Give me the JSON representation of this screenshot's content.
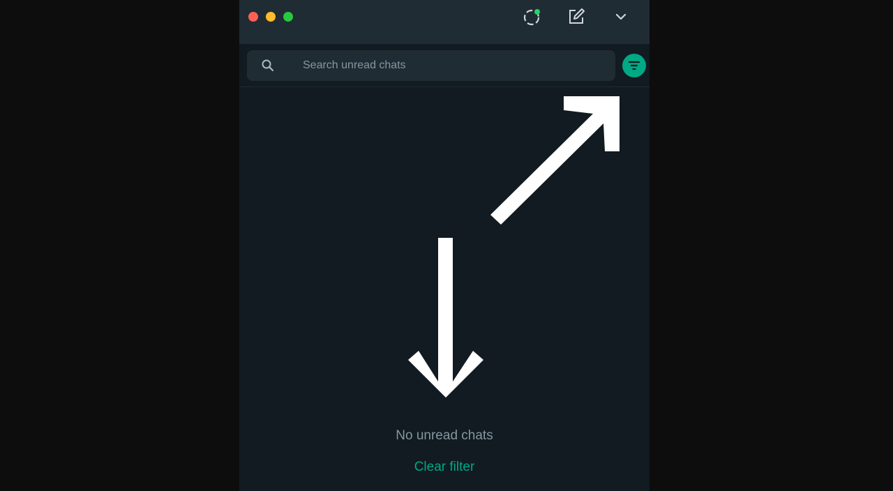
{
  "window": {
    "controls": [
      "close",
      "minimize",
      "maximize"
    ],
    "toolbar": {
      "status_icon": "status-ring-icon",
      "new_chat_icon": "new-chat-icon",
      "menu_icon": "chevron-down-icon"
    }
  },
  "search": {
    "placeholder": "Search unread chats",
    "value": "",
    "icon": "search-icon"
  },
  "filter": {
    "icon": "filter-icon",
    "active": true,
    "color": "#00a884"
  },
  "empty_state": {
    "message": "No unread chats",
    "action_label": "Clear filter"
  },
  "colors": {
    "accent": "#00a884",
    "panel": "#111b21",
    "header": "#202c33"
  }
}
